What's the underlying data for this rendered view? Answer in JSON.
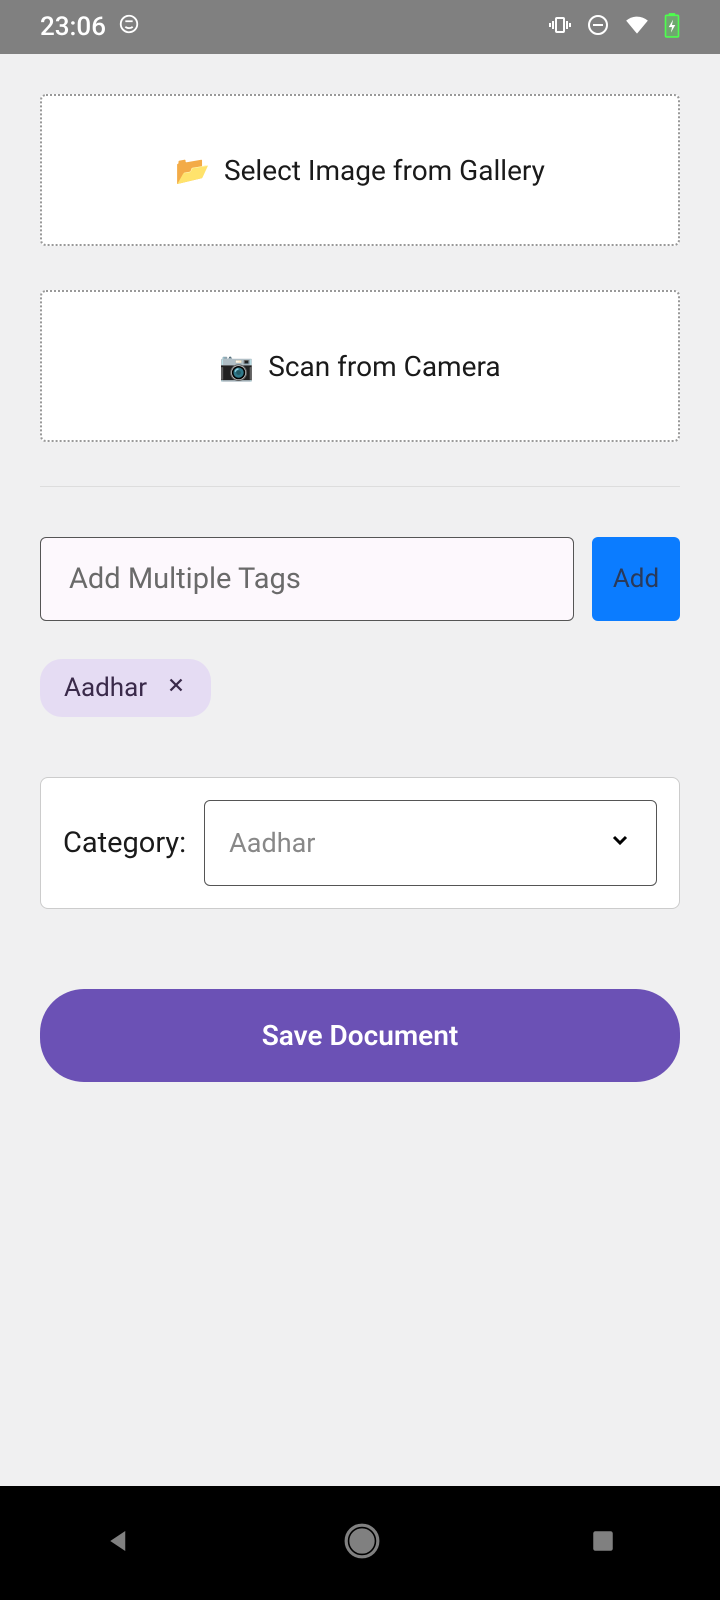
{
  "statusbar": {
    "time": "23:06"
  },
  "upload": {
    "gallery_icon": "📂",
    "gallery_label": "Select Image from Gallery",
    "camera_icon": "📷",
    "camera_label": "Scan from Camera"
  },
  "tags": {
    "placeholder": "Add Multiple Tags",
    "add_label": "Add",
    "chips": [
      {
        "label": "Aadhar"
      }
    ]
  },
  "category": {
    "label": "Category:",
    "selected": "Aadhar"
  },
  "save_label": "Save Document"
}
